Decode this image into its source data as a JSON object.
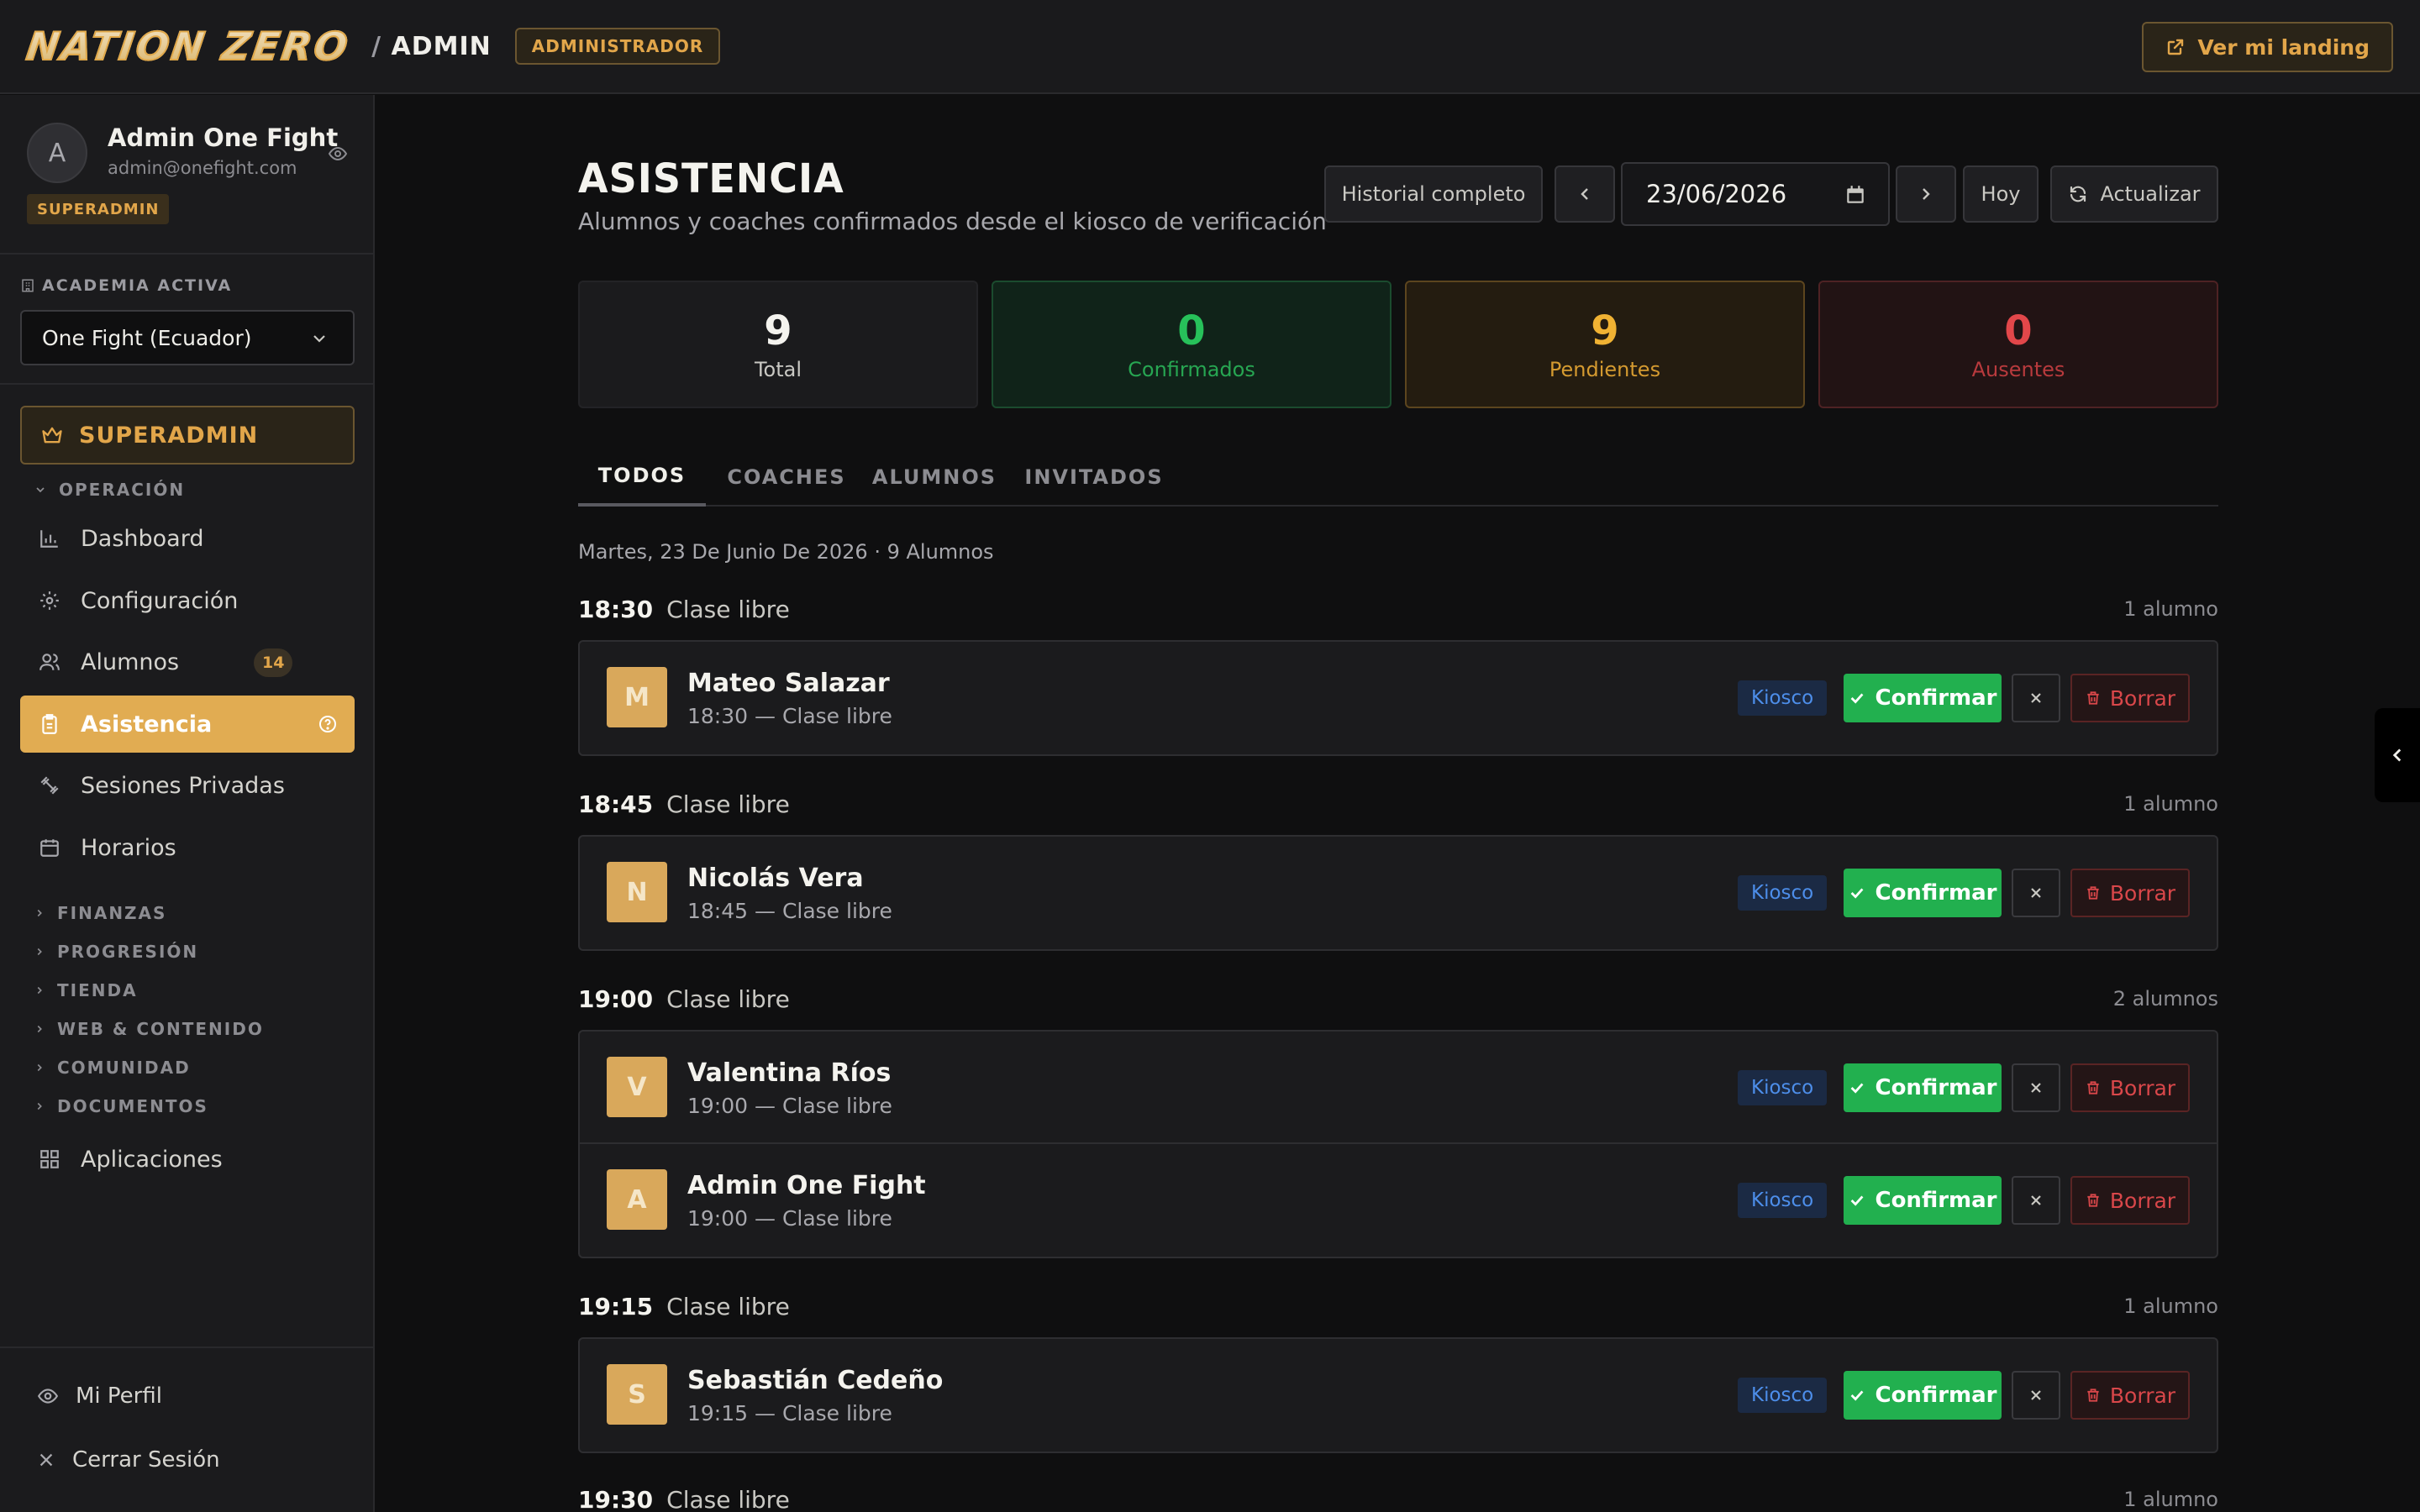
{
  "header": {
    "brand": "NATION ZERO",
    "sep": "/",
    "section": "ADMIN",
    "role_tag": "ADMINISTRADOR",
    "landing_label": "Ver mi landing"
  },
  "sidebar": {
    "profile": {
      "initial": "A",
      "name": "Admin One Fight",
      "email": "admin@onefight.com",
      "badge": "SUPERADMIN"
    },
    "academy": {
      "label": "ACADEMIA ACTIVA",
      "selected": "One Fight (Ecuador)"
    },
    "superadmin_label": "SUPERADMIN",
    "operacion_label": "OPERACIÓN",
    "items": [
      {
        "label": "Dashboard",
        "icon": "bar-chart-icon"
      },
      {
        "label": "Configuración",
        "icon": "gear-icon"
      },
      {
        "label": "Alumnos",
        "icon": "users-icon",
        "badge": "14"
      },
      {
        "label": "Asistencia",
        "icon": "clipboard-icon"
      },
      {
        "label": "Sesiones Privadas",
        "icon": "dumbbell-icon"
      },
      {
        "label": "Horarios",
        "icon": "calendar-icon"
      }
    ],
    "sections": [
      "FINANZAS",
      "PROGRESIÓN",
      "TIENDA",
      "WEB & CONTENIDO",
      "COMUNIDAD",
      "DOCUMENTOS"
    ],
    "apps_label": "Aplicaciones",
    "footer": {
      "profile_label": "Mi Perfil",
      "logout_label": "Cerrar Sesión"
    }
  },
  "main": {
    "title": "ASISTENCIA",
    "subtitle": "Alumnos y coaches confirmados desde el kiosco de verificación",
    "toolbar": {
      "history": "Historial completo",
      "date": "23/06/2026",
      "today": "Hoy",
      "refresh": "Actualizar"
    },
    "stats": [
      {
        "value": "9",
        "label": "Total"
      },
      {
        "value": "0",
        "label": "Confirmados"
      },
      {
        "value": "9",
        "label": "Pendientes"
      },
      {
        "value": "0",
        "label": "Ausentes"
      }
    ],
    "tabs": [
      "TODOS",
      "COACHES",
      "ALUMNOS",
      "INVITADOS"
    ],
    "date_line": "Martes, 23 De Junio De 2026 · 9 Alumnos",
    "groups": [
      {
        "time": "18:30",
        "class": "Clase libre",
        "count": "1 alumno",
        "rows": [
          {
            "initial": "M",
            "name": "Mateo Salazar",
            "sub": "18:30 — Clase libre"
          }
        ]
      },
      {
        "time": "18:45",
        "class": "Clase libre",
        "count": "1 alumno",
        "rows": [
          {
            "initial": "N",
            "name": "Nicolás Vera",
            "sub": "18:45 — Clase libre"
          }
        ]
      },
      {
        "time": "19:00",
        "class": "Clase libre",
        "count": "2 alumnos",
        "rows": [
          {
            "initial": "V",
            "name": "Valentina Ríos",
            "sub": "19:00 — Clase libre"
          },
          {
            "initial": "A",
            "name": "Admin One Fight",
            "sub": "19:00 — Clase libre"
          }
        ]
      },
      {
        "time": "19:15",
        "class": "Clase libre",
        "count": "1 alumno",
        "rows": [
          {
            "initial": "S",
            "name": "Sebastián Cedeño",
            "sub": "19:15 — Clase libre"
          }
        ]
      },
      {
        "time": "19:30",
        "class": "Clase libre",
        "count": "1 alumno",
        "rows": []
      }
    ],
    "row_actions": {
      "source": "Kiosco",
      "confirm": "Confirmar",
      "delete": "Borrar"
    }
  },
  "colors": {
    "accent": "#e1ac52",
    "confirm": "#22b04f",
    "danger": "#d9474a",
    "kiosco": "#4d8eea"
  }
}
